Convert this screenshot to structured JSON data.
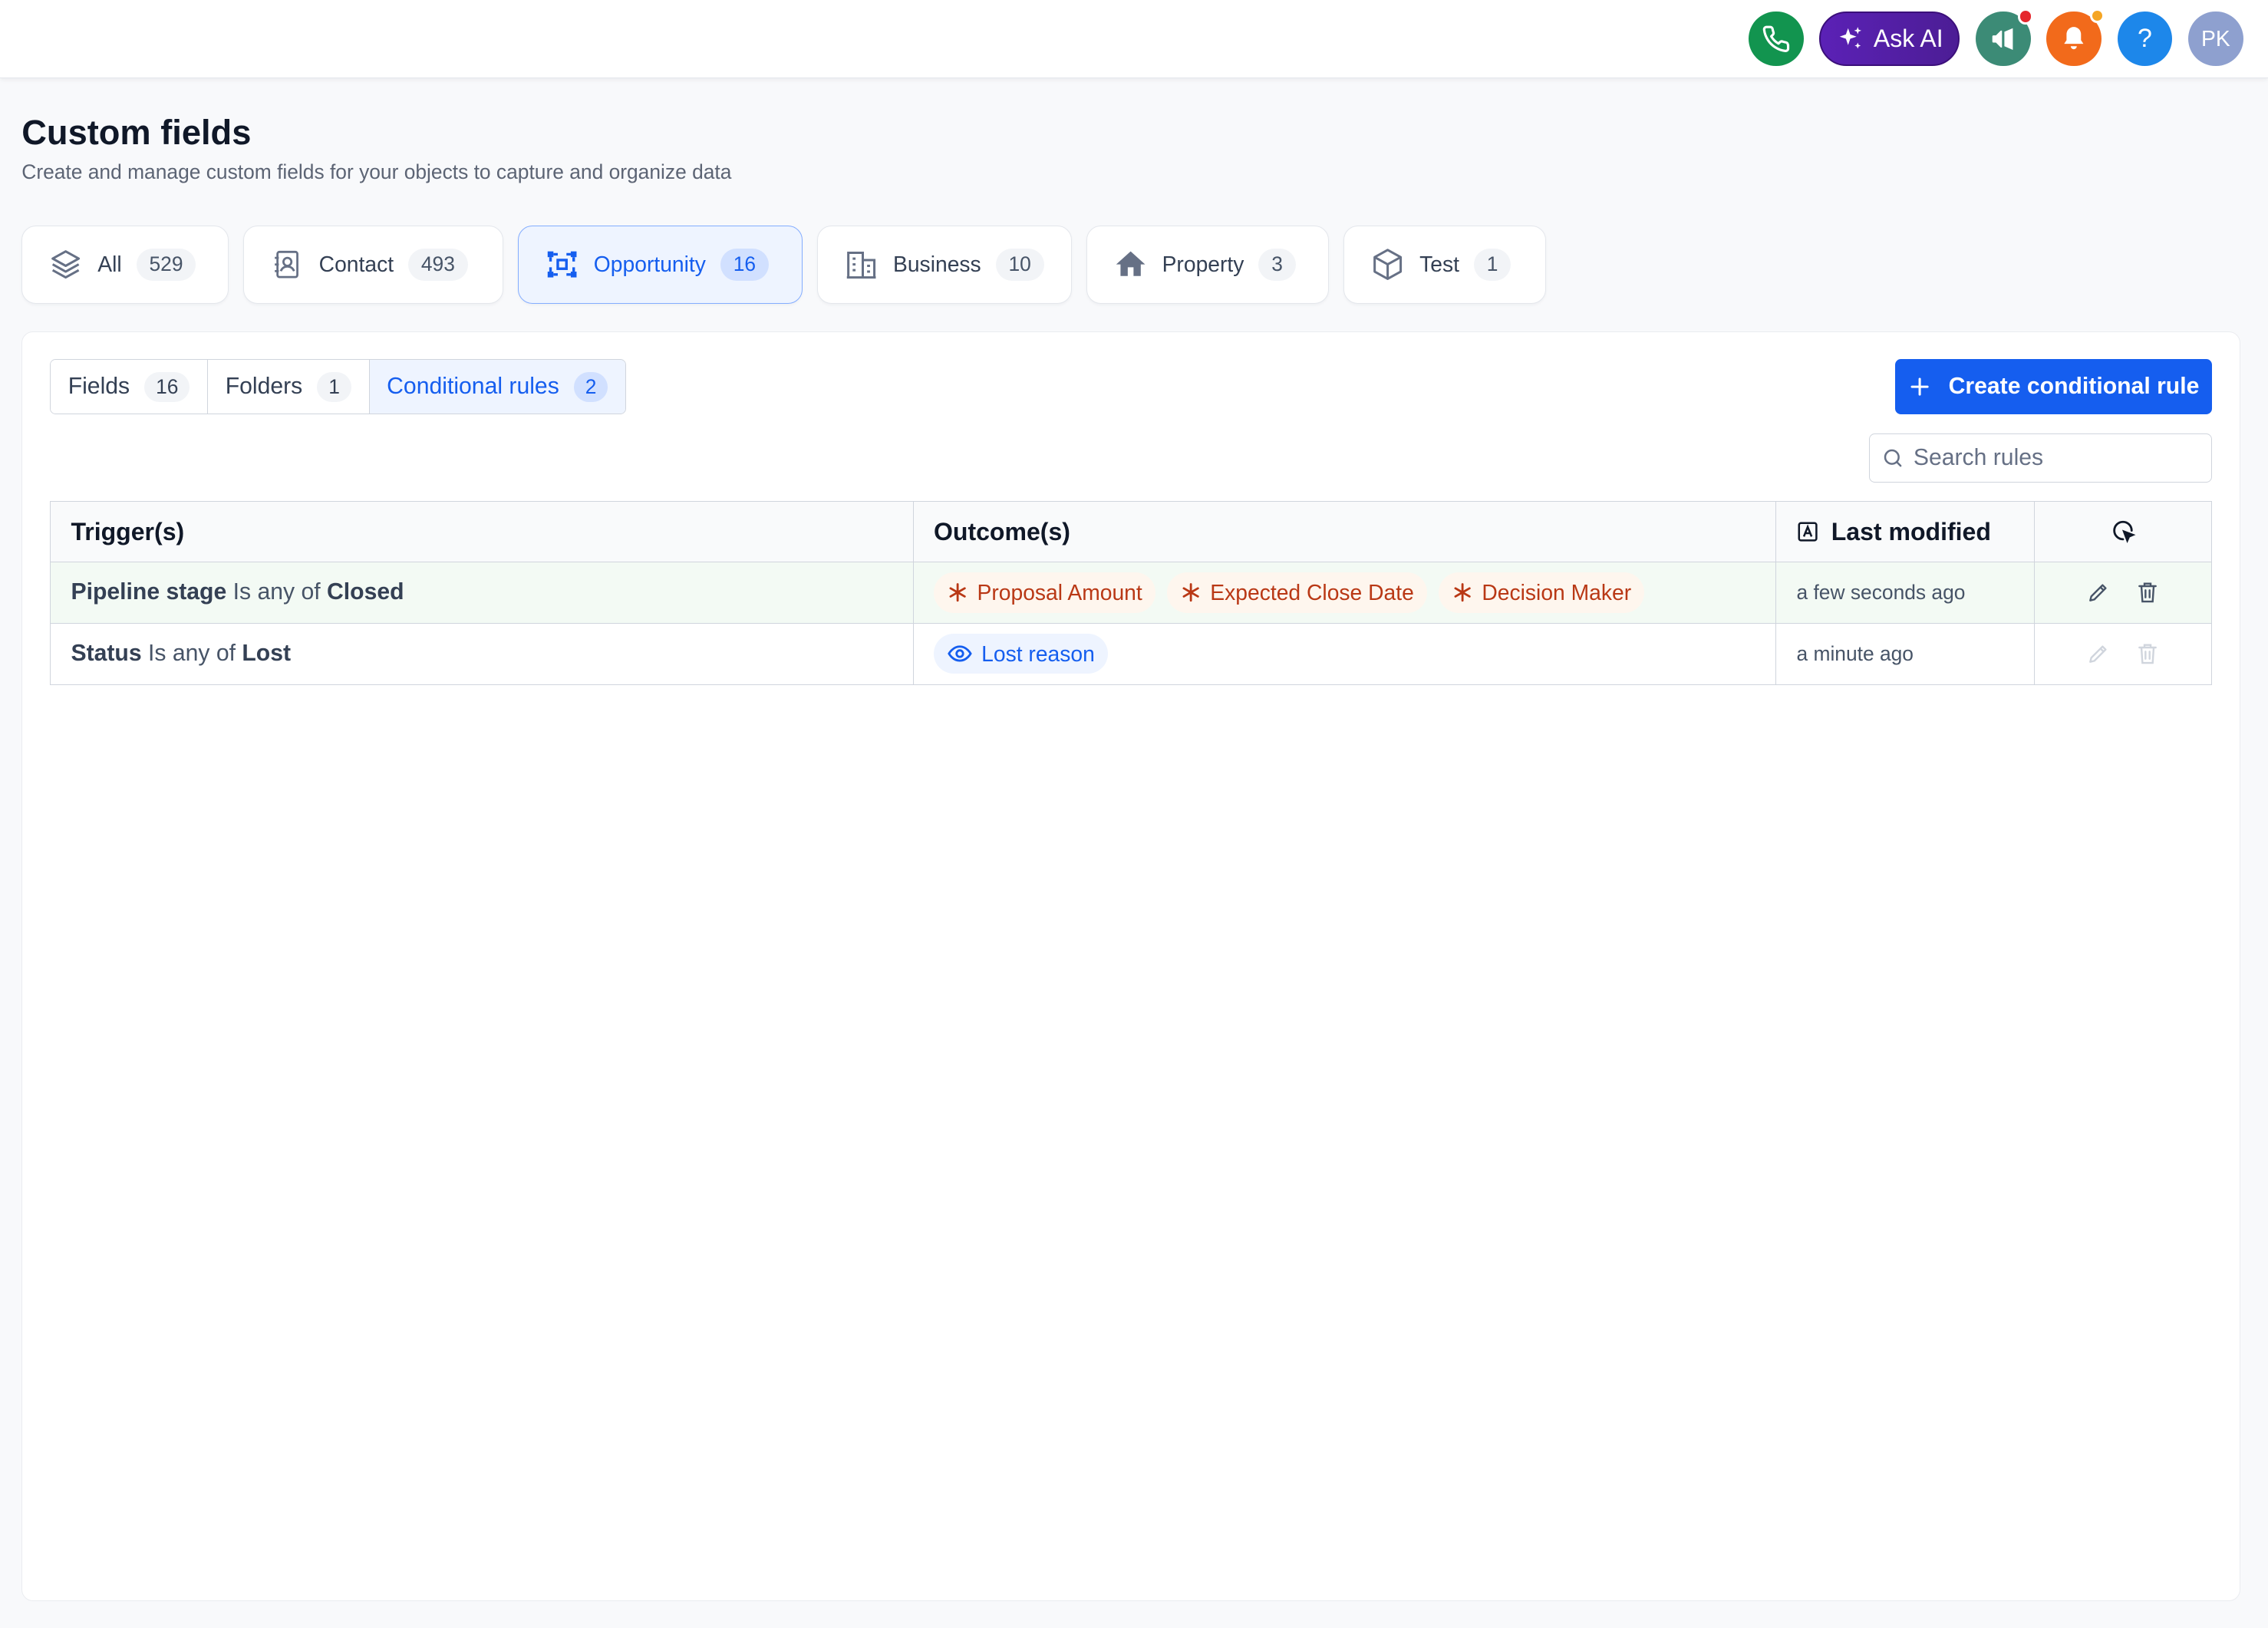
{
  "topbar": {
    "ask_ai_label": "Ask AI",
    "help_label": "?",
    "avatar_initials": "PK"
  },
  "header": {
    "title": "Custom fields",
    "subtitle": "Create and manage custom fields for your objects to capture and organize data"
  },
  "object_tabs": [
    {
      "label": "All",
      "count": "529",
      "icon": "layers-icon"
    },
    {
      "label": "Contact",
      "count": "493",
      "icon": "contact-book-icon"
    },
    {
      "label": "Opportunity",
      "count": "16",
      "icon": "opportunity-icon",
      "active": true
    },
    {
      "label": "Business",
      "count": "10",
      "icon": "building-icon"
    },
    {
      "label": "Property",
      "count": "3",
      "icon": "house-icon"
    },
    {
      "label": "Test",
      "count": "1",
      "icon": "cube-icon"
    }
  ],
  "sub_tabs": [
    {
      "label": "Fields",
      "count": "16"
    },
    {
      "label": "Folders",
      "count": "1"
    },
    {
      "label": "Conditional rules",
      "count": "2",
      "active": true
    }
  ],
  "create_button_label": "Create conditional rule",
  "search": {
    "placeholder": "Search rules"
  },
  "table": {
    "headers": {
      "trigger": "Trigger(s)",
      "outcome": "Outcome(s)",
      "modified": "Last modified"
    },
    "rows": [
      {
        "trigger_field": "Pipeline stage",
        "trigger_operator": "Is any of",
        "trigger_value": "Closed",
        "outcomes": [
          "Proposal Amount",
          "Expected Close Date",
          "Decision Maker"
        ],
        "outcome_type": "required",
        "modified": "a few seconds ago"
      },
      {
        "trigger_field": "Status",
        "trigger_operator": "Is any of",
        "trigger_value": "Lost",
        "outcomes": [
          "Lost reason"
        ],
        "outcome_type": "visible",
        "modified": "a minute ago"
      }
    ]
  },
  "colors": {
    "primary": "#155eef",
    "phone": "#12944f",
    "ask_ai": "#5b21b6",
    "announcement": "#3c8b76",
    "notifications": "#f26a1b",
    "help": "#1d87ea",
    "avatar": "#8ea0cf",
    "required_pill_text": "#b93815",
    "required_pill_bg": "#fef6ee"
  }
}
